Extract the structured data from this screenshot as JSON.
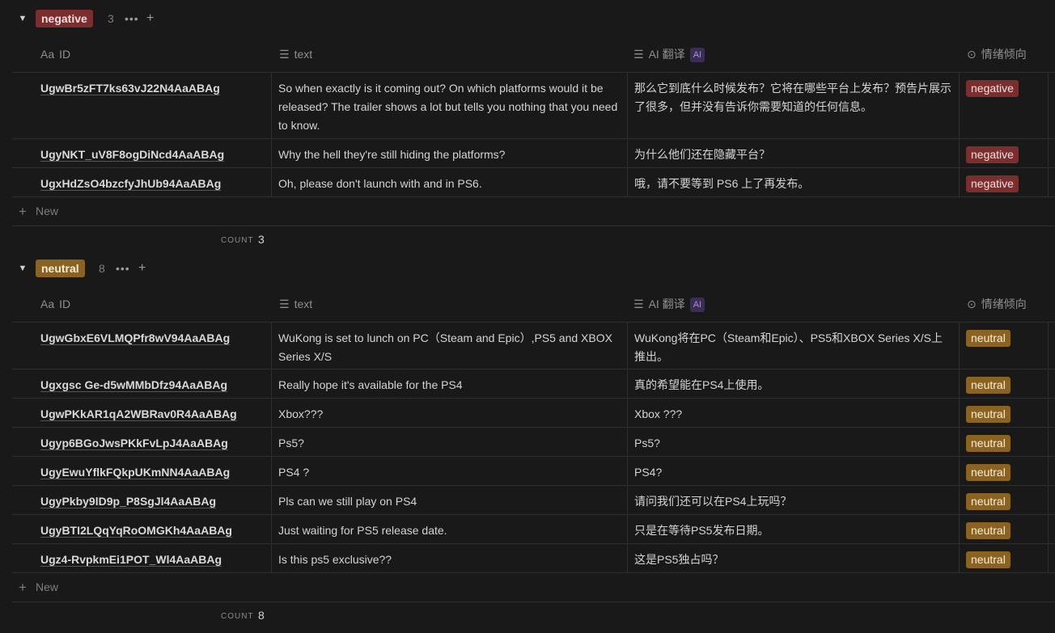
{
  "columns": {
    "id": "ID",
    "id_prefix": "Aa",
    "text": "text",
    "translation": "AI 翻译",
    "ai_badge": "AI",
    "sentiment": "情绪倾向"
  },
  "new_label": "New",
  "count_label": "COUNT",
  "groups": [
    {
      "label": "negative",
      "count": "3",
      "footer_count": "3",
      "rows": [
        {
          "id": "UgwBr5zFT7ks63vJ22N4AaABAg",
          "text": "So when exactly is it coming out? On which platforms would it be released? The trailer shows a lot but tells you nothing that you need to know.",
          "translation": "那么它到底什么时候发布？它将在哪些平台上发布？预告片展示了很多，但并没有告诉你需要知道的任何信息。",
          "tag": "negative"
        },
        {
          "id": "UgyNKT_uV8F8ogDiNcd4AaABAg",
          "text": "Why the hell they're still hiding the platforms?",
          "translation": "为什么他们还在隐藏平台？",
          "tag": "negative"
        },
        {
          "id": "UgxHdZsO4bzcfyJhUb94AaABAg",
          "text": "Oh, please don't launch with and in PS6.",
          "translation": "哦，请不要等到 PS6 上了再发布。",
          "tag": "negative"
        }
      ]
    },
    {
      "label": "neutral",
      "count": "8",
      "footer_count": "8",
      "rows": [
        {
          "id": "UgwGbxE6VLMQPfr8wV94AaABAg",
          "text": "WuKong is set to lunch on PC（Steam and Epic）,PS5 and XBOX Series X/S",
          "translation": "WuKong将在PC（Steam和Epic）、PS5和XBOX Series X/S上推出。",
          "tag": "neutral"
        },
        {
          "id": "Ugxgsc Ge-d5wMMbDfz94AaABAg",
          "text": "Really hope it's available for the PS4",
          "translation": "真的希望能在PS4上使用。",
          "tag": "neutral"
        },
        {
          "id": "UgwPKkAR1qA2WBRav0R4AaABAg",
          "text": "Xbox???",
          "translation": "Xbox ???",
          "tag": "neutral"
        },
        {
          "id": "Ugyp6BGoJwsPKkFvLpJ4AaABAg",
          "text": "Ps5?",
          "translation": "Ps5?",
          "tag": "neutral"
        },
        {
          "id": "UgyEwuYflkFQkpUKmNN4AaABAg",
          "text": "PS4 ?",
          "translation": "PS4?",
          "tag": "neutral"
        },
        {
          "id": "UgyPkby9lD9p_P8SgJl4AaABAg",
          "text": "Pls can we still play on PS4",
          "translation": "请问我们还可以在PS4上玩吗？",
          "tag": "neutral"
        },
        {
          "id": "UgyBTI2LQqYqRoOMGKh4AaABAg",
          "text": "Just waiting for PS5 release date.",
          "translation": "只是在等待PS5发布日期。",
          "tag": "neutral"
        },
        {
          "id": "Ugz4-RvpkmEi1POT_Wl4AaABAg",
          "text": "Is this ps5 exclusive??",
          "translation": "这是PS5独占吗？",
          "tag": "neutral"
        }
      ]
    }
  ],
  "colors": {
    "background": "#191919",
    "negative": "#7a2e2e",
    "neutral": "#8a6322",
    "ai_badge": "#3b2d55"
  },
  "icons": {
    "toggle": "triangle-down-icon",
    "more": "more-icon",
    "add": "plus-icon",
    "text_column": "lines-icon",
    "sentiment_column": "select-circle-icon"
  }
}
